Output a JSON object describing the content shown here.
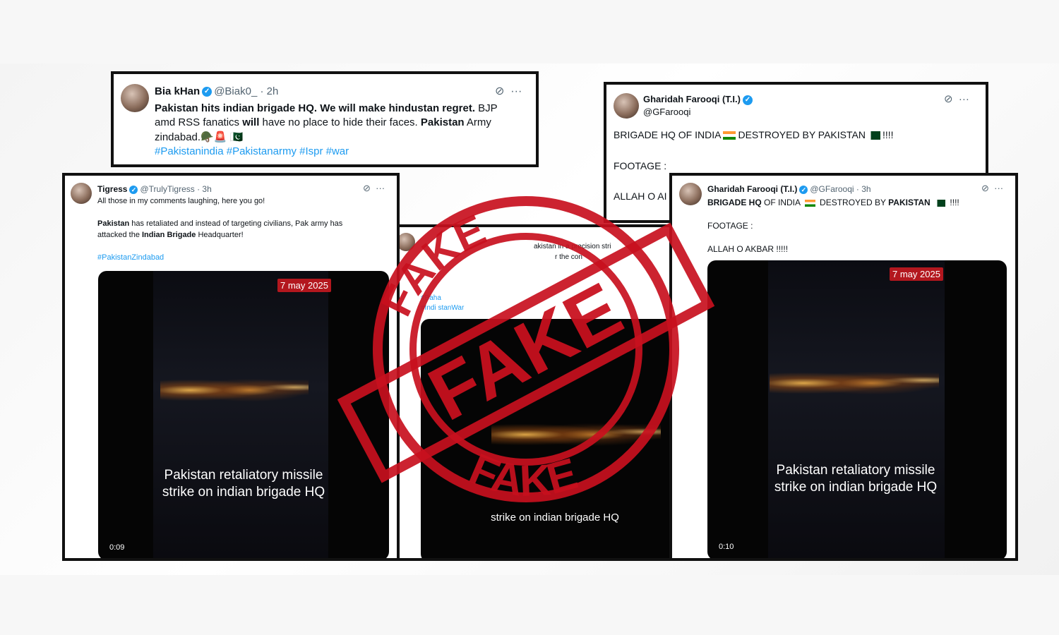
{
  "tweet_bia": {
    "name": "Bia kHan",
    "handle": "@Biak0_ · 2h",
    "line1_bold": "Pakistan hits indian brigade HQ. We will make hindustan regret.",
    "line1_tail": " BJP",
    "line2_a": "amd RSS fanatics ",
    "line2_bold": "will",
    "line2_b": " have no place to hide their faces. ",
    "line2_bold2": "Pakistan",
    "line2_c": " Army",
    "line3": "zindabad.🪖🚨 🇵🇰",
    "hashtags": "#Pakistanindia #Pakistanarmy #Ispr #war"
  },
  "tweet_tigress": {
    "name": "Tigress",
    "handle": "@TrulyTigress · 3h",
    "line1": "All those in my comments laughing, here you go!",
    "line2_bold": "Pakistan",
    "line2_rest": " has retaliated and instead of targeting civilians, Pak army has",
    "line3_a": "attacked the ",
    "line3_bold": "Indian Brigade",
    "line3_b": " Headquarter!",
    "hashtag": "#PakistanZindabad",
    "video_date": "7 may 2025",
    "video_caption_1": "Pakistan retaliatory missile",
    "video_caption_2": "strike on indian brigade HQ",
    "video_duration": "0:09"
  },
  "tweet_middle": {
    "frag_1": "akistan in a precision stri",
    "frag_2": "r the con",
    "frag_3": "#Baha",
    "frag_4": "#Indi     stanWar",
    "caption_frag": "strike on indian brigade HQ"
  },
  "tweet_gharidah_top": {
    "name": "Gharidah Farooqi (T.I.)",
    "handle": "@GFarooqi",
    "line1_a": "BRIGADE HQ OF INDIA",
    "line1_b": "DESTROYED BY PAKISTAN",
    "line1_c": "!!!!",
    "line2": "FOOTAGE :",
    "line3": "ALLAH O AI"
  },
  "tweet_gharidah_front": {
    "name": "Gharidah Farooqi (T.I.)",
    "handle": "@GFarooqi · 3h",
    "line1_a": "BRIGADE HQ",
    "line1_b": " OF INDIA ",
    "line1_c": " DESTROYED BY ",
    "line1_d": "PAKISTAN",
    "line1_e": " !!!!",
    "line2": "FOOTAGE :",
    "line3": "ALLAH O AKBAR !!!!!",
    "video_date": "7 may 2025",
    "video_caption_1": "Pakistan retaliatory missile",
    "video_caption_2": "strike on indian brigade HQ",
    "video_duration": "0:10"
  },
  "stamp": {
    "word": "FAKE",
    "color": "#c8101e"
  },
  "icons": [
    "grok-icon",
    "more-icon",
    "verified-icon",
    "flag-india",
    "flag-pakistan"
  ]
}
